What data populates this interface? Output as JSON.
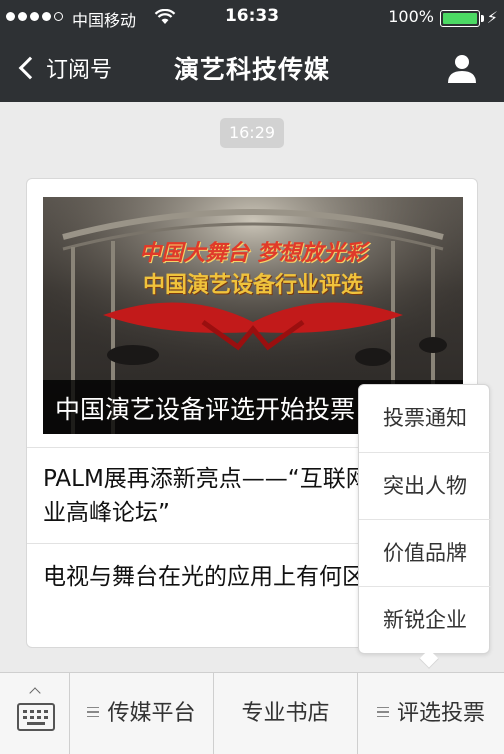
{
  "status_bar": {
    "carrier": "中国移动",
    "time": "16:33",
    "battery": "100%",
    "battery_level": 1.0,
    "bolt_icon": "⚡"
  },
  "nav": {
    "back_label": "订阅号",
    "title": "演艺科技传媒"
  },
  "timestamp": "16:29",
  "card": {
    "cover": {
      "image_title_1": "中国大舞台 梦想放光彩",
      "image_title_2": "中国演艺设备行业评选",
      "overlay_text": "中国演艺设备评选开始投票"
    },
    "articles": [
      {
        "title": "PALM展再添新亮点——“互联网+KTV行业高峰论坛”"
      },
      {
        "title": "电视与舞台在光的应用上有何区别?"
      }
    ]
  },
  "popup_menu": {
    "items": [
      {
        "label": "投票通知"
      },
      {
        "label": "突出人物"
      },
      {
        "label": "价值品牌"
      },
      {
        "label": "新锐企业"
      }
    ]
  },
  "bottom_menu": {
    "items": [
      {
        "label": "传媒平台"
      },
      {
        "label": "专业书店"
      },
      {
        "label": "评选投票"
      }
    ]
  },
  "colors": {
    "nav_bg": "#2e3134",
    "battery_green": "#4cd964",
    "page_bg": "#ebebeb"
  }
}
